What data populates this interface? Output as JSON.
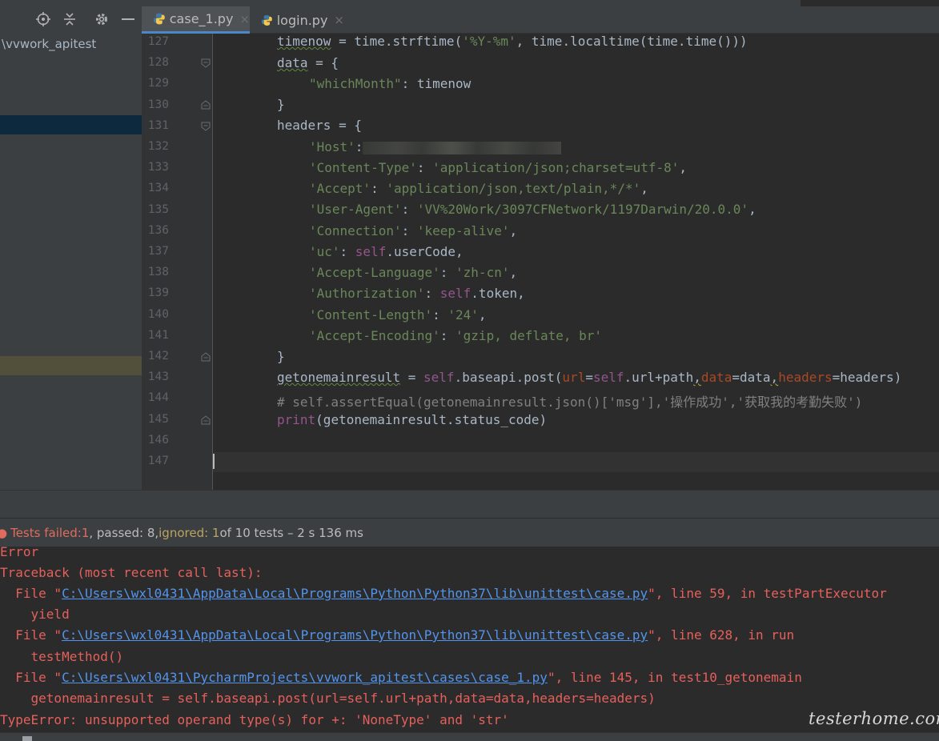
{
  "project": {
    "root_label": "vvwork_apitest"
  },
  "tabs": [
    {
      "label": "case_1.py",
      "close": "×",
      "active": true
    },
    {
      "label": "login.py",
      "close": "×",
      "active": false
    }
  ],
  "editor": {
    "line_numbers": [
      "127",
      "128",
      "129",
      "130",
      "131",
      "132",
      "133",
      "134",
      "135",
      "136",
      "137",
      "138",
      "139",
      "140",
      "141",
      "142",
      "143",
      "144",
      "145",
      "146",
      "147"
    ],
    "code": {
      "l127_var": "timenow",
      "l127_rest_a": " = time.strftime(",
      "l127_str": "'%Y-%m'",
      "l127_rest_b": ", time.localtime(time.time()))",
      "l128_var": "data",
      "l128_rest": " = {",
      "l129_key": "\"whichMonth\"",
      "l129_rest": ": timenow",
      "l130": "}",
      "l131": "headers = {",
      "l132_key": "'Host'",
      "l132_colon": ":",
      "l133_key": "'Content-Type'",
      "l133_val": "'application/json;charset=utf-8'",
      "l134_key": "'Accept'",
      "l134_val": "'application/json,text/plain,*/*'",
      "l135_key": "'User-Agent'",
      "l135_val": "'VV%20Work/3097CFNetwork/1197Darwin/20.0.0'",
      "l136_key": "'Connection'",
      "l136_val": "'keep-alive'",
      "l137_key": "'uc'",
      "l137_self": "self",
      "l137_rest": ".userCode",
      "l138_key": "'Accept-Language'",
      "l138_val": "'zh-cn'",
      "l139_key": "'Authorization'",
      "l139_self": "self",
      "l139_rest": ".token",
      "l140_key": "'Content-Length'",
      "l140_val": "'24'",
      "l141_key": "'Accept-Encoding'",
      "l141_val": "'gzip, deflate, br'",
      "l142": "}",
      "l143_var": "getonemainresult",
      "l143_a": " = ",
      "l143_self1": "self",
      "l143_b": ".baseapi.post(",
      "l143_p1": "url",
      "l143_c": "=",
      "l143_self2": "self",
      "l143_d": ".url+path",
      "l143_comma1": ",",
      "l143_p2": "data",
      "l143_e": "=data",
      "l143_comma2": ",",
      "l143_p3": "headers",
      "l143_f": "=headers)",
      "l144": "# self.assertEqual(getonemainresult.json()['msg'],'操作成功','获取我的考勤失败')",
      "l145_fn": "print",
      "l145_rest": "(getonemainresult.status_code)"
    }
  },
  "test_status": {
    "failed_label": "Tests failed: ",
    "failed_count": "1",
    "passed_text": ", passed: 8, ",
    "ignored_text": "ignored: 1",
    "rest": " of 10 tests – 2 s 136 ms"
  },
  "console": {
    "l1": "Error",
    "l2": "Traceback (most recent call last):",
    "l3_pre": "  File \"",
    "l3_link": "C:\\Users\\wxl0431\\AppData\\Local\\Programs\\Python\\Python37\\lib\\unittest\\case.py",
    "l3_post": "\", line 59, in testPartExecutor",
    "l4": "    yield",
    "l5_pre": "  File \"",
    "l5_link": "C:\\Users\\wxl0431\\AppData\\Local\\Programs\\Python\\Python37\\lib\\unittest\\case.py",
    "l5_post": "\", line 628, in run",
    "l6": "    testMethod()",
    "l7_pre": "  File \"",
    "l7_link": "C:\\Users\\wxl0431\\PycharmProjects\\vvwork_apitest\\cases\\case_1.py",
    "l7_post": "\", line 145, in test10_getonemain",
    "l8": "    getonemainresult = self.baseapi.post(url=self.url+path,data=data,headers=headers)",
    "l9": "TypeError: unsupported operand type(s) for +: 'NoneType' and 'str'"
  },
  "watermark": "testerhome.com",
  "colors": {
    "accent": "#4a88c7",
    "error": "#e6605b",
    "link": "#5394ec"
  }
}
